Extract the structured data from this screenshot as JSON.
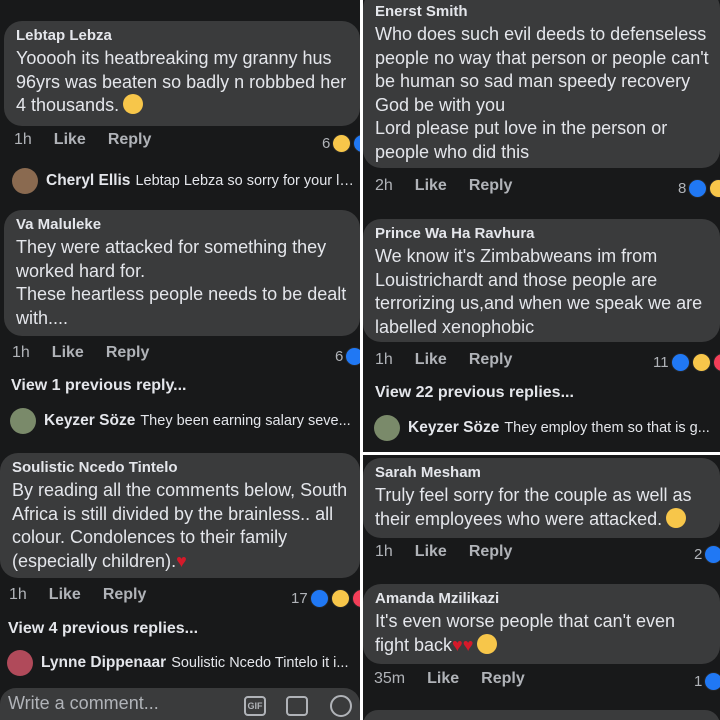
{
  "left": {
    "c1": {
      "name": "Lebtap Lebza",
      "text": "Yooooh its heatbreaking my granny hus 96yrs was beaten so badly n robbbed her 4 thousands.",
      "time": "1h",
      "like": "Like",
      "reply": "Reply",
      "reactions": "6",
      "reply_preview": {
        "name": "Cheryl Ellis",
        "text": "Lebtap Lebza so sorry for your lo..."
      }
    },
    "c2": {
      "name": "Va Maluleke",
      "text": "They were attacked for something they worked hard for.\nThese heartless people needs to be dealt with....",
      "time": "1h",
      "like": "Like",
      "reply": "Reply",
      "reactions": "6",
      "view_previous": "View 1 previous reply...",
      "reply_preview": {
        "name": "Keyzer Söze",
        "text": "They been earning salary seve..."
      }
    },
    "c3": {
      "name": "Soulistic Ncedo Tintelo",
      "text": "By reading all the comments below, South Africa is still divided by the brainless.. all colour. Condolences to their family (especially children).",
      "time": "1h",
      "like": "Like",
      "reply": "Reply",
      "reactions": "17",
      "view_previous": "View 4 previous replies...",
      "reply_preview": {
        "name": "Lynne Dippenaar",
        "text": "Soulistic Ncedo Tintelo it i..."
      }
    },
    "composer": {
      "placeholder": "Write a comment...",
      "gif": "GIF"
    }
  },
  "right": {
    "c1": {
      "name": "Enerst Smith",
      "text": "Who does such evil deeds to defenseless people no way that person or people can't be human so sad man speedy recovery God be with you\nLord please put love in the person or people who did this",
      "time": "2h",
      "like": "Like",
      "reply": "Reply",
      "reactions": "8"
    },
    "c2": {
      "name": "Prince Wa Ha Ravhura",
      "text": "We know it's Zimbabweans im from Louistrichardt and those people are terrorizing us,and when we speak we are labelled xenophobic",
      "time": "1h",
      "like": "Like",
      "reply": "Reply",
      "reactions": "11",
      "view_previous": "View 22 previous replies...",
      "reply_preview": {
        "name": "Keyzer Söze",
        "text": "They employ them so that is g..."
      }
    },
    "c3": {
      "name": "Sarah Mesham",
      "text": "Truly feel sorry for the couple as well as their employees who were attacked.",
      "time": "1h",
      "like": "Like",
      "reply": "Reply",
      "reactions": "2"
    },
    "c4": {
      "name": "Amanda Mzilikazi",
      "text": "It's even worse people that can't even fight back",
      "time": "35m",
      "like": "Like",
      "reply": "Reply",
      "reactions": "1"
    }
  },
  "colors": {
    "background": "#18191a",
    "bubble": "#3a3b3c",
    "text": "#e4e6eb",
    "muted": "#b0b3b8",
    "like_blue": "#2078f4"
  }
}
